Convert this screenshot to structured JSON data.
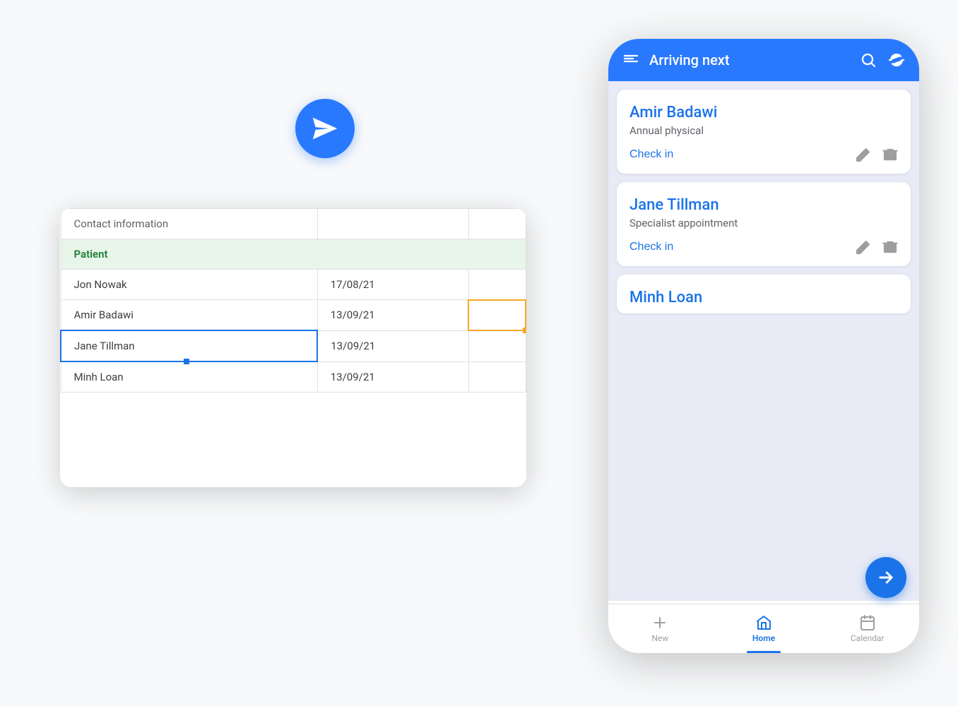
{
  "scene": {
    "background": "#f8f9fa"
  },
  "paper_plane": {
    "bg_color": "#2979ff",
    "aria_label": "App icon"
  },
  "spreadsheet": {
    "header_row": {
      "col1": "Contact information",
      "col2": "",
      "col3": ""
    },
    "section_row": {
      "label": "Patient"
    },
    "rows": [
      {
        "name": "Jon Nowak",
        "date": "17/08/21",
        "col3": ""
      },
      {
        "name": "Amir Badawi",
        "date": "13/09/21",
        "col3": ""
      },
      {
        "name": "Jane Tillman",
        "date": "13/09/21",
        "col3": ""
      },
      {
        "name": "Minh Loan",
        "date": "13/09/21",
        "col3": ""
      }
    ]
  },
  "phone": {
    "header": {
      "title": "Arriving next",
      "menu_icon": "menu-icon",
      "search_icon": "search-icon",
      "refresh_icon": "refresh-icon"
    },
    "patients": [
      {
        "name": "Amir Badawi",
        "appointment_type": "Annual physical",
        "check_in_label": "Check in"
      },
      {
        "name": "Jane Tillman",
        "appointment_type": "Specialist appointment",
        "check_in_label": "Check in"
      },
      {
        "name": "Minh Loan",
        "appointment_type": "",
        "check_in_label": ""
      }
    ],
    "bottom_nav": [
      {
        "label": "New",
        "icon": "plus-icon",
        "active": false
      },
      {
        "label": "Home",
        "icon": "home-icon",
        "active": true
      },
      {
        "label": "Calendar",
        "icon": "calendar-icon",
        "active": false
      }
    ],
    "fab_icon": "arrow-right-icon"
  }
}
